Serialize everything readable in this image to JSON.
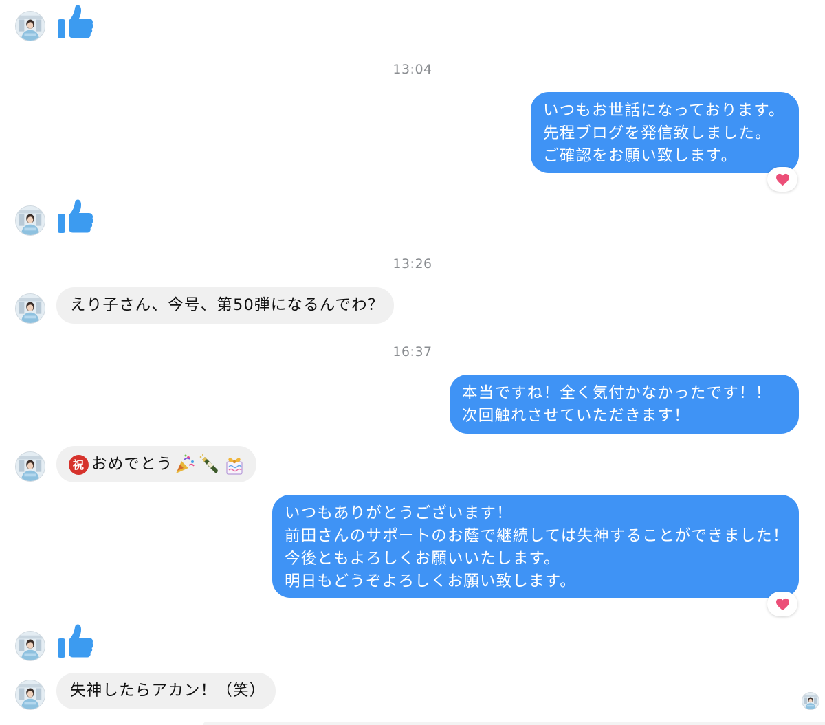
{
  "timestamps": {
    "t1": "13:04",
    "t2": "13:26",
    "t3": "16:37"
  },
  "messages": {
    "out1": [
      "いつもお世話になっております。",
      "先程ブログを発信致しました。",
      "ご確認をお願い致します。"
    ],
    "in1": "えり子さん、今号、第50弾になるんでわ？",
    "out2": [
      "本当ですね！全く気付かなかったです！！",
      "次回触れさせていただきます！"
    ],
    "in2_badge": "祝",
    "in2_text": "おめでとう",
    "out3": [
      "いつもありがとうございます！",
      "前田さんのサポートのお蔭で継続しては失神することができました！",
      "今後ともよろしくお願いいたします。",
      "明日もどうぞよろしくお願い致します。"
    ],
    "in3": "失神したらアカン！（笑）"
  },
  "icons": {
    "like": "thumbs-up-icon",
    "reaction": "heart-icon",
    "emojis": [
      "party-popper-icon",
      "champagne-icon",
      "gift-ribbon-icon"
    ]
  },
  "colors": {
    "outgoing_bubble": "#3f93f5",
    "incoming_bubble": "#f0f0f0",
    "like_blue": "#3c9bf0",
    "heart_pink": "#ec4f78",
    "timestamp": "#8a8d91"
  }
}
